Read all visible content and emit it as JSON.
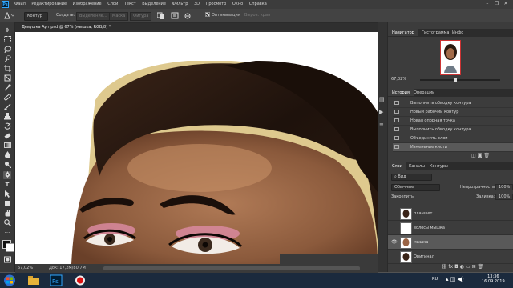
{
  "menubar": {
    "app": "Ps",
    "items": [
      "Файл",
      "Редактирование",
      "Изображение",
      "Слои",
      "Текст",
      "Выделение",
      "Фильтр",
      "3D",
      "Просмотр",
      "Окно",
      "Справка"
    ],
    "window_buttons": [
      "–",
      "❐",
      "✕"
    ]
  },
  "options": {
    "mode": "Контур",
    "build": "Создать:",
    "selection": "Выделение...",
    "mask": "Маска",
    "shape": "Фигура",
    "align_edges": "Оптимизация",
    "align_paths": "Выров. края"
  },
  "document": {
    "tab_title": "Девушка Арт.psd @ 67% (мышка, RGB/8) *",
    "zoom": "67,02%",
    "status": "Док: 17,2М/80,7М"
  },
  "navigator": {
    "tabs": [
      "Навигатор",
      "Гистограмма",
      "Инфо"
    ],
    "zoom": "67,02%"
  },
  "history": {
    "tabs": [
      "История",
      "Операции"
    ],
    "items": [
      "Выполнить обводку контура",
      "Новый рабочий контур",
      "Новая опорная точка",
      "Выполнить обводку контура",
      "Объединить слои",
      "Изменение кисти"
    ]
  },
  "layers": {
    "tabs": [
      "Слои",
      "Каналы",
      "Контуры"
    ],
    "filter": "Вид",
    "blend": "Обычные",
    "opacity_label": "Непрозрачность:",
    "opacity": "100%",
    "lock_label": "Закрепить:",
    "fill_label": "Заливка:",
    "fill": "100%",
    "items": [
      {
        "name": "планшет",
        "visible": false
      },
      {
        "name": "волосы мышка",
        "visible": false
      },
      {
        "name": "мышка",
        "visible": true
      },
      {
        "name": "Оригинал",
        "visible": false
      }
    ]
  },
  "taskbar": {
    "lang": "RU",
    "time": "13:36",
    "date": "16.09.2019"
  },
  "colors": {
    "accent": "#31a8ff",
    "panel": "#3c3c3c",
    "selected_row": "#595959"
  }
}
